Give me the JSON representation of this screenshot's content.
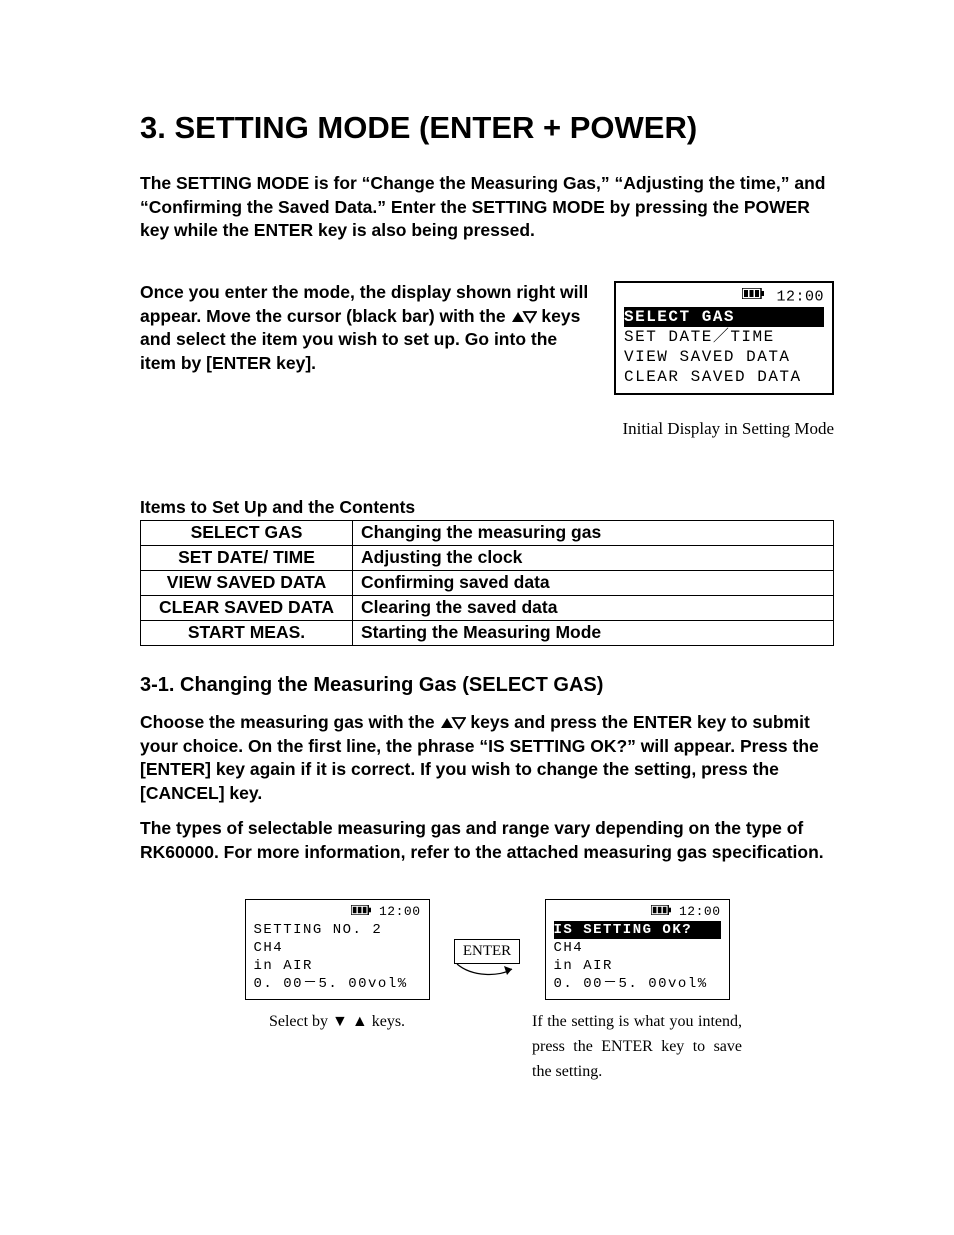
{
  "title": "3. SETTING MODE (ENTER + POWER)",
  "para1": "The SETTING MODE is for “Change the Measuring Gas,” “Adjusting the time,” and “Confirming the Saved Data.” Enter the SETTING MODE by pressing the POWER key while the ENTER key is also being pressed.",
  "introL1": "Once you enter the mode, the display shown right will appear. Move the cursor (black bar) with the ",
  "introL2": " keys and select the item you wish to set up. Go into the item by [ENTER key].",
  "lcd1": {
    "time": "12:00",
    "lines": [
      "SELECT GAS",
      "SET DATE／TIME",
      "VIEW SAVED DATA",
      "CLEAR SAVED DATA"
    ],
    "selectedIndex": 0,
    "caption": "Initial Display in Setting Mode"
  },
  "tableHeading": "Items to Set Up and the Contents",
  "tableRows": [
    {
      "item": "SELECT GAS",
      "desc": "Changing the measuring gas"
    },
    {
      "item": "SET DATE/ TIME",
      "desc": "Adjusting the clock"
    },
    {
      "item": "VIEW SAVED DATA",
      "desc": "Confirming saved data"
    },
    {
      "item": "CLEAR SAVED DATA",
      "desc": "Clearing the saved data"
    },
    {
      "item": "START MEAS.",
      "desc": "Starting the Measuring Mode"
    }
  ],
  "sub": "3-1. Changing the Measuring Gas (SELECT GAS)",
  "p3a": "Choose the measuring gas with the ",
  "p3b": " keys and press the ENTER key to submit your choice. On the first line, the phrase “IS SETTING OK?” will appear. Press the [ENTER] key again if it is correct. If you wish to change the setting, press the [CANCEL] key.",
  "p4": "The types of selectable measuring gas and range vary depending on the type of RK60000. For more information, refer to the attached measuring gas specification.",
  "lcd2": {
    "time": "12:00",
    "lines": [
      "SETTING NO. 2",
      "CH4",
      "in AIR",
      "0. 00－5. 00vol%"
    ],
    "caption": "Select by ▼ ▲ keys."
  },
  "enterLabel": "ENTER",
  "lcd3": {
    "time": "12:00",
    "lines": [
      "IS SETTING OK?",
      "CH4",
      "in AIR",
      "0. 00－5. 00vol%"
    ],
    "selectedIndex": 0,
    "caption": "If the setting is what you intend, press the ENTER key to save the setting."
  }
}
